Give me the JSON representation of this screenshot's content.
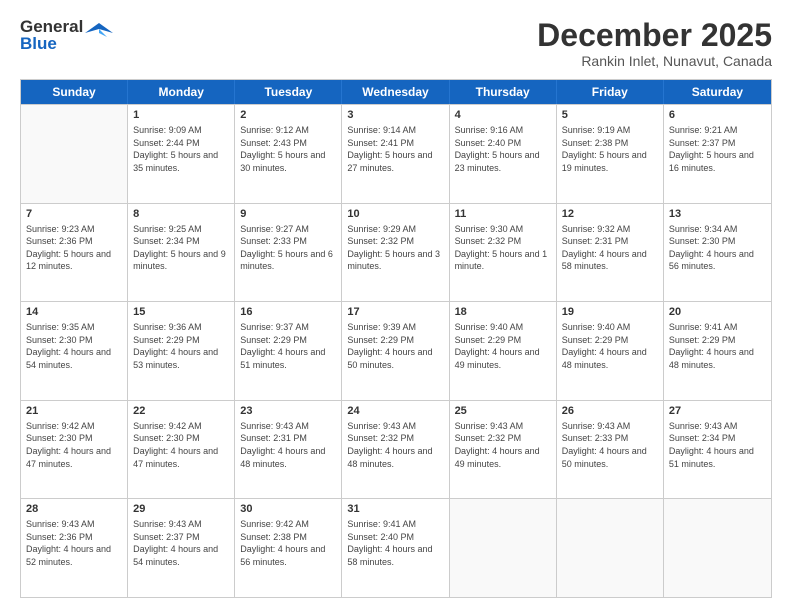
{
  "logo": {
    "line1": "General",
    "line2": "Blue"
  },
  "title": "December 2025",
  "subtitle": "Rankin Inlet, Nunavut, Canada",
  "weekdays": [
    "Sunday",
    "Monday",
    "Tuesday",
    "Wednesday",
    "Thursday",
    "Friday",
    "Saturday"
  ],
  "rows": [
    [
      {
        "day": "",
        "sunrise": "",
        "sunset": "",
        "daylight": ""
      },
      {
        "day": "1",
        "sunrise": "Sunrise: 9:09 AM",
        "sunset": "Sunset: 2:44 PM",
        "daylight": "Daylight: 5 hours and 35 minutes."
      },
      {
        "day": "2",
        "sunrise": "Sunrise: 9:12 AM",
        "sunset": "Sunset: 2:43 PM",
        "daylight": "Daylight: 5 hours and 30 minutes."
      },
      {
        "day": "3",
        "sunrise": "Sunrise: 9:14 AM",
        "sunset": "Sunset: 2:41 PM",
        "daylight": "Daylight: 5 hours and 27 minutes."
      },
      {
        "day": "4",
        "sunrise": "Sunrise: 9:16 AM",
        "sunset": "Sunset: 2:40 PM",
        "daylight": "Daylight: 5 hours and 23 minutes."
      },
      {
        "day": "5",
        "sunrise": "Sunrise: 9:19 AM",
        "sunset": "Sunset: 2:38 PM",
        "daylight": "Daylight: 5 hours and 19 minutes."
      },
      {
        "day": "6",
        "sunrise": "Sunrise: 9:21 AM",
        "sunset": "Sunset: 2:37 PM",
        "daylight": "Daylight: 5 hours and 16 minutes."
      }
    ],
    [
      {
        "day": "7",
        "sunrise": "Sunrise: 9:23 AM",
        "sunset": "Sunset: 2:36 PM",
        "daylight": "Daylight: 5 hours and 12 minutes."
      },
      {
        "day": "8",
        "sunrise": "Sunrise: 9:25 AM",
        "sunset": "Sunset: 2:34 PM",
        "daylight": "Daylight: 5 hours and 9 minutes."
      },
      {
        "day": "9",
        "sunrise": "Sunrise: 9:27 AM",
        "sunset": "Sunset: 2:33 PM",
        "daylight": "Daylight: 5 hours and 6 minutes."
      },
      {
        "day": "10",
        "sunrise": "Sunrise: 9:29 AM",
        "sunset": "Sunset: 2:32 PM",
        "daylight": "Daylight: 5 hours and 3 minutes."
      },
      {
        "day": "11",
        "sunrise": "Sunrise: 9:30 AM",
        "sunset": "Sunset: 2:32 PM",
        "daylight": "Daylight: 5 hours and 1 minute."
      },
      {
        "day": "12",
        "sunrise": "Sunrise: 9:32 AM",
        "sunset": "Sunset: 2:31 PM",
        "daylight": "Daylight: 4 hours and 58 minutes."
      },
      {
        "day": "13",
        "sunrise": "Sunrise: 9:34 AM",
        "sunset": "Sunset: 2:30 PM",
        "daylight": "Daylight: 4 hours and 56 minutes."
      }
    ],
    [
      {
        "day": "14",
        "sunrise": "Sunrise: 9:35 AM",
        "sunset": "Sunset: 2:30 PM",
        "daylight": "Daylight: 4 hours and 54 minutes."
      },
      {
        "day": "15",
        "sunrise": "Sunrise: 9:36 AM",
        "sunset": "Sunset: 2:29 PM",
        "daylight": "Daylight: 4 hours and 53 minutes."
      },
      {
        "day": "16",
        "sunrise": "Sunrise: 9:37 AM",
        "sunset": "Sunset: 2:29 PM",
        "daylight": "Daylight: 4 hours and 51 minutes."
      },
      {
        "day": "17",
        "sunrise": "Sunrise: 9:39 AM",
        "sunset": "Sunset: 2:29 PM",
        "daylight": "Daylight: 4 hours and 50 minutes."
      },
      {
        "day": "18",
        "sunrise": "Sunrise: 9:40 AM",
        "sunset": "Sunset: 2:29 PM",
        "daylight": "Daylight: 4 hours and 49 minutes."
      },
      {
        "day": "19",
        "sunrise": "Sunrise: 9:40 AM",
        "sunset": "Sunset: 2:29 PM",
        "daylight": "Daylight: 4 hours and 48 minutes."
      },
      {
        "day": "20",
        "sunrise": "Sunrise: 9:41 AM",
        "sunset": "Sunset: 2:29 PM",
        "daylight": "Daylight: 4 hours and 48 minutes."
      }
    ],
    [
      {
        "day": "21",
        "sunrise": "Sunrise: 9:42 AM",
        "sunset": "Sunset: 2:30 PM",
        "daylight": "Daylight: 4 hours and 47 minutes."
      },
      {
        "day": "22",
        "sunrise": "Sunrise: 9:42 AM",
        "sunset": "Sunset: 2:30 PM",
        "daylight": "Daylight: 4 hours and 47 minutes."
      },
      {
        "day": "23",
        "sunrise": "Sunrise: 9:43 AM",
        "sunset": "Sunset: 2:31 PM",
        "daylight": "Daylight: 4 hours and 48 minutes."
      },
      {
        "day": "24",
        "sunrise": "Sunrise: 9:43 AM",
        "sunset": "Sunset: 2:32 PM",
        "daylight": "Daylight: 4 hours and 48 minutes."
      },
      {
        "day": "25",
        "sunrise": "Sunrise: 9:43 AM",
        "sunset": "Sunset: 2:32 PM",
        "daylight": "Daylight: 4 hours and 49 minutes."
      },
      {
        "day": "26",
        "sunrise": "Sunrise: 9:43 AM",
        "sunset": "Sunset: 2:33 PM",
        "daylight": "Daylight: 4 hours and 50 minutes."
      },
      {
        "day": "27",
        "sunrise": "Sunrise: 9:43 AM",
        "sunset": "Sunset: 2:34 PM",
        "daylight": "Daylight: 4 hours and 51 minutes."
      }
    ],
    [
      {
        "day": "28",
        "sunrise": "Sunrise: 9:43 AM",
        "sunset": "Sunset: 2:36 PM",
        "daylight": "Daylight: 4 hours and 52 minutes."
      },
      {
        "day": "29",
        "sunrise": "Sunrise: 9:43 AM",
        "sunset": "Sunset: 2:37 PM",
        "daylight": "Daylight: 4 hours and 54 minutes."
      },
      {
        "day": "30",
        "sunrise": "Sunrise: 9:42 AM",
        "sunset": "Sunset: 2:38 PM",
        "daylight": "Daylight: 4 hours and 56 minutes."
      },
      {
        "day": "31",
        "sunrise": "Sunrise: 9:41 AM",
        "sunset": "Sunset: 2:40 PM",
        "daylight": "Daylight: 4 hours and 58 minutes."
      },
      {
        "day": "",
        "sunrise": "",
        "sunset": "",
        "daylight": ""
      },
      {
        "day": "",
        "sunrise": "",
        "sunset": "",
        "daylight": ""
      },
      {
        "day": "",
        "sunrise": "",
        "sunset": "",
        "daylight": ""
      }
    ]
  ]
}
